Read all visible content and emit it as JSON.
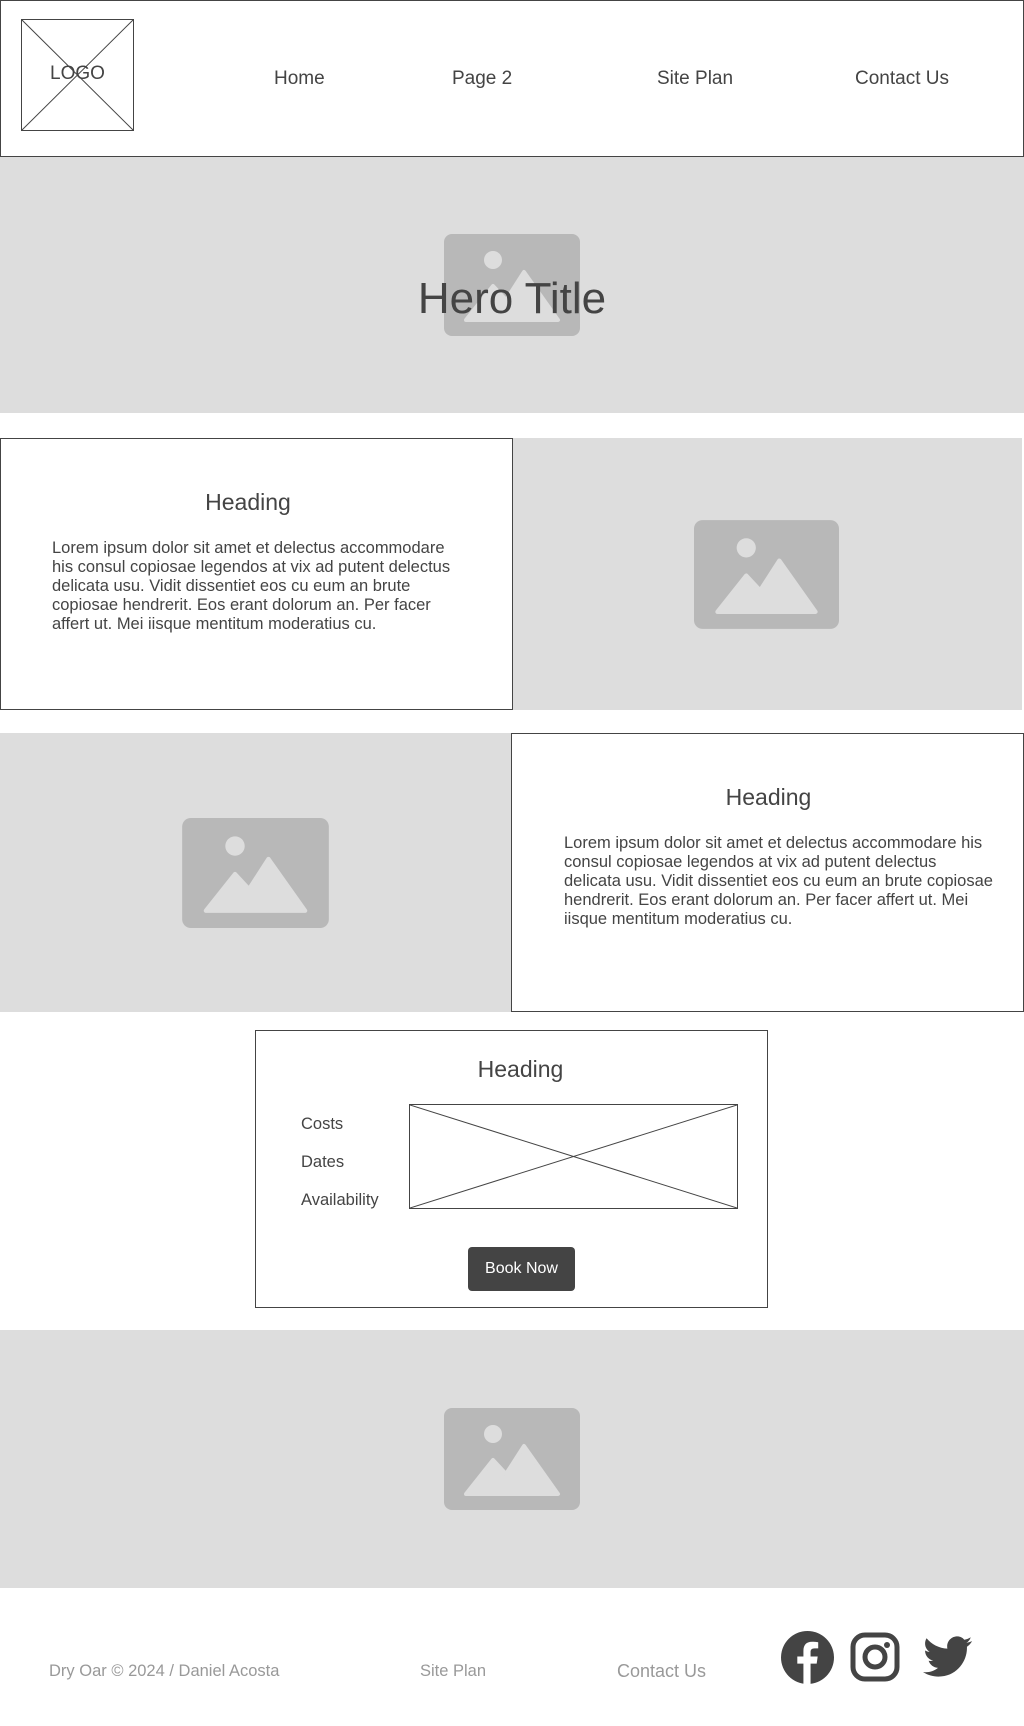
{
  "header": {
    "logo_text": "LOGO",
    "nav": [
      {
        "label": "Home"
      },
      {
        "label": "Page 2"
      },
      {
        "label": "Site Plan"
      },
      {
        "label": "Contact Us"
      }
    ]
  },
  "hero": {
    "title": "Hero Title",
    "image_icon": "image-placeholder-icon"
  },
  "feature_1": {
    "heading": "Heading",
    "text": "Lorem ipsum dolor sit amet et delectus accommodare his consul copiosae legendos at vix ad putent delectus delicata usu. Vidit dissentiet eos cu eum an brute copiosae hendrerit. Eos erant dolorum an. Per facer affert ut. Mei iisque mentitum moderatius cu."
  },
  "feature_2": {
    "heading": "Heading",
    "text": "Lorem ipsum dolor sit amet et delectus accommodare his consul copiosae legendos at vix ad putent delectus delicata usu. Vidit dissentiet eos cu eum an brute copiosae hendrerit. Eos erant dolorum an. Per facer affert ut. Mei iisque mentitum moderatius cu."
  },
  "booking": {
    "heading": "Heading",
    "labels": [
      "Costs",
      "Dates",
      "Availability"
    ],
    "button_label": "Book Now"
  },
  "footer": {
    "copyright": "Dry Oar © 2024 / Daniel Acosta",
    "site_plan": "Site Plan",
    "contact": "Contact Us",
    "social_icons": [
      "facebook-icon",
      "instagram-icon",
      "twitter-icon"
    ]
  },
  "colors": {
    "dark": "#444444",
    "placeholder_bg": "#dddddd",
    "placeholder_icon": "#b8b8b8",
    "footer_text": "#999999"
  }
}
